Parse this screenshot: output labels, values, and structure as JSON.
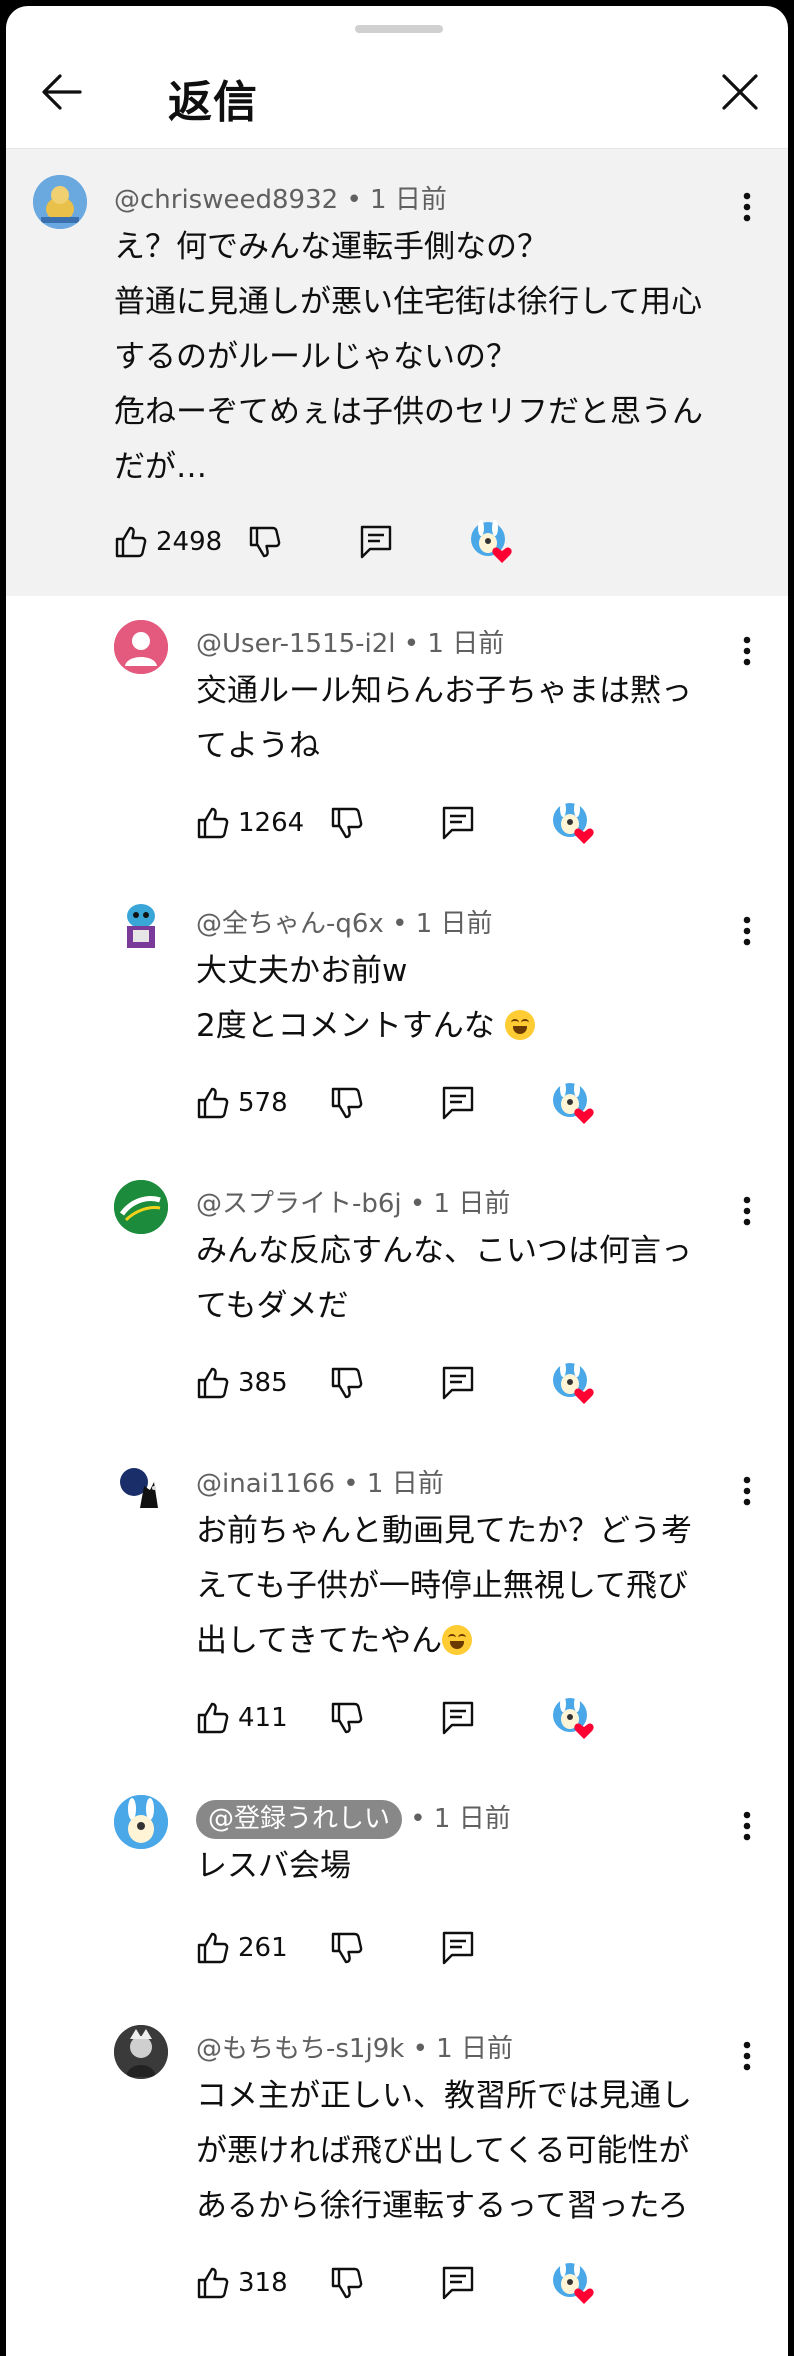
{
  "header": {
    "title": "返信"
  },
  "comments": [
    {
      "handle": "@chrisweed8932",
      "time": "1 日前",
      "lines": [
        "え？何でみんな運転手側なの？",
        "普通に見通しが悪い住宅街は徐行して用心",
        "するのがルールじゃないの？",
        "危ねーぞてめぇは子供のセリフだと思うん",
        "だが…"
      ],
      "likes": "2498",
      "avatar": "avatar-chrisweed"
    },
    {
      "handle": "@User-1515-i2l",
      "time": "1 日前",
      "lines": [
        "交通ルール知らんお子ちゃまは黙っ",
        "てようね"
      ],
      "likes": "1264",
      "avatar": "avatar-default-pink"
    },
    {
      "handle": "@全ちゃん-q6x",
      "time": "1 日前",
      "lines": [
        "大丈夫かお前w",
        "2度とコメントすんな"
      ],
      "likes": "578",
      "avatar": "avatar-character"
    },
    {
      "handle": "@スプライト-b6j",
      "time": "1 日前",
      "lines": [
        "みんな反応すんな、こいつは何言っ",
        "てもダメだ"
      ],
      "likes": "385",
      "avatar": "avatar-sprite-logo"
    },
    {
      "handle": "@inai1166",
      "time": "1 日前",
      "lines": [
        "お前ちゃんと動画見てたか？どう考",
        "えても子供が一時停止無視して飛び",
        "出してきてたやん"
      ],
      "likes": "411",
      "avatar": "avatar-wolf"
    },
    {
      "handle": "@登録うれしい",
      "time": "1 日前",
      "lines": [
        "レスバ会場"
      ],
      "likes": "261",
      "avatar": "avatar-bunny-channel"
    },
    {
      "handle": "@もちもち-s1j9k",
      "time": "1 日前",
      "lines": [
        "コメ主が正しい、教習所では見通し",
        "が悪ければ飛び出してくる可能性が",
        "あるから徐行運転するって習ったろ"
      ],
      "likes": "318",
      "avatar": "avatar-dark-character"
    }
  ],
  "meta_separator": "•",
  "colors": {
    "heart": "#ff0033",
    "parent_bg": "#f2f2f2",
    "secondary_text": "#606060"
  }
}
